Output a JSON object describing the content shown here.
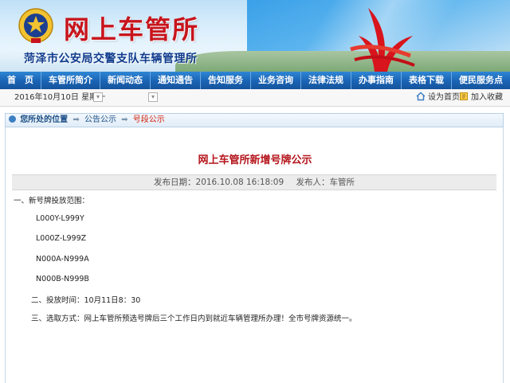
{
  "header": {
    "logo_text": "网上车管所",
    "subtitle": "菏泽市公安局交警支队车辆管理所"
  },
  "nav": [
    "首　页",
    "车管所简介",
    "新闻动态",
    "通知通告",
    "告知服务",
    "业务咨询",
    "法律法规",
    "办事指南",
    "表格下载",
    "便民服务点"
  ],
  "infobar": {
    "date": "2016年10月10日  星期一",
    "set_home": "设为首页",
    "add_fav": "加入收藏"
  },
  "breadcrumb": {
    "label": "您所处的位置",
    "items": [
      "公告公示",
      "号段公示"
    ]
  },
  "article": {
    "title": "网上车管所新增号牌公示",
    "publish_date": "发布日期：2016.10.08 16:18:09",
    "publisher": "发布人：车管所",
    "lines": [
      "一、新号牌投放范围：",
      "L000Y-L999Y",
      "L000Z-L999Z",
      "N000A-N999A",
      "N000B-N999B",
      "二、投放时间：10月11日8：30",
      "三、选取方式：网上车管所预选号牌后三个工作日内到就近车辆管理所办理！全市号牌资源统一。"
    ]
  },
  "colors": {
    "nav_bg": "#1a63b4",
    "title_red": "#b4141b",
    "logo_red": "#c8141c",
    "subtitle_blue": "#0f3b8c"
  }
}
